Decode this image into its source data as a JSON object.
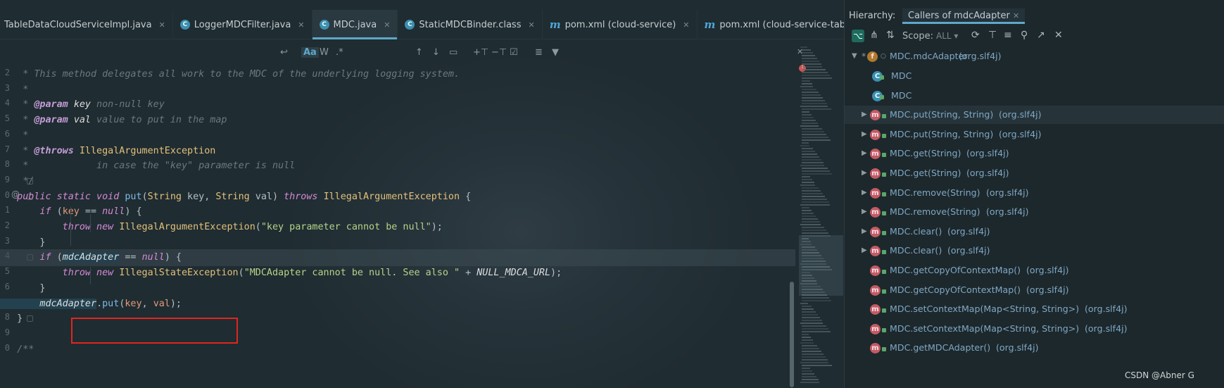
{
  "tabs": [
    {
      "label": "TableDataCloudServiceImpl.java",
      "icon": "class-icon"
    },
    {
      "label": "LoggerMDCFilter.java",
      "icon": "class-icon"
    },
    {
      "label": "MDC.java",
      "icon": "class-icon"
    },
    {
      "label": "StaticMDCBinder.class",
      "icon": "class-icon"
    },
    {
      "label": "pom.xml (cloud-service)",
      "icon": "maven-icon"
    },
    {
      "label": "pom.xml (cloud-service-tabledata)",
      "icon": "maven-icon"
    }
  ],
  "active_tab": "MDC.java",
  "editor_toolbar": {
    "match_case": "Aa",
    "words": "W",
    "regex": ".*"
  },
  "line_numbers": [
    "2",
    "3",
    "4",
    "5",
    "6",
    "7",
    "8",
    "9",
    "0",
    "1",
    "2",
    "3",
    "4",
    "5",
    "6",
    "7",
    "8",
    "9",
    "0"
  ],
  "code": [
    [
      {
        "c": "cmt",
        "t": "    * This method delegates all work to the MDC of the underlying logging system."
      }
    ],
    [
      {
        "c": "cmt",
        "t": "    *"
      }
    ],
    [
      {
        "c": "cmt",
        "t": "    * "
      },
      {
        "c": "tag",
        "t": "@param"
      },
      {
        "c": "cmt",
        "t": " "
      },
      {
        "c": "fld",
        "t": "key"
      },
      {
        "c": "cmt",
        "t": " non-null key"
      }
    ],
    [
      {
        "c": "cmt",
        "t": "    * "
      },
      {
        "c": "tag",
        "t": "@param"
      },
      {
        "c": "cmt",
        "t": " "
      },
      {
        "c": "fld",
        "t": "val"
      },
      {
        "c": "cmt",
        "t": " value to put in the map"
      }
    ],
    [
      {
        "c": "cmt",
        "t": "    *"
      }
    ],
    [
      {
        "c": "cmt",
        "t": "    * "
      },
      {
        "c": "tag",
        "t": "@throws"
      },
      {
        "c": "cmt",
        "t": " "
      },
      {
        "c": "ty",
        "t": "IllegalArgumentException"
      }
    ],
    [
      {
        "c": "cmt",
        "t": "    *            in case the \"key\" parameter is null"
      }
    ],
    [
      {
        "c": "cmt",
        "t": "    */"
      }
    ],
    [
      {
        "c": "kw",
        "t": "   public static void "
      },
      {
        "c": "fn",
        "t": "put"
      },
      {
        "c": "pl",
        "t": "("
      },
      {
        "c": "ty",
        "t": "String"
      },
      {
        "c": "pl",
        "t": " key, "
      },
      {
        "c": "ty",
        "t": "String"
      },
      {
        "c": "pl",
        "t": " val) "
      },
      {
        "c": "kw",
        "t": "throws "
      },
      {
        "c": "ty",
        "t": "IllegalArgumentException"
      },
      {
        "c": "pl",
        "t": " {"
      }
    ],
    [
      {
        "c": "kw",
        "t": "       if "
      },
      {
        "c": "pl",
        "t": "("
      },
      {
        "c": "prm",
        "t": "key"
      },
      {
        "c": "pl",
        "t": " == "
      },
      {
        "c": "kw",
        "t": "null"
      },
      {
        "c": "pl",
        "t": ") {"
      }
    ],
    [
      {
        "c": "kw",
        "t": "           throw new "
      },
      {
        "c": "ty",
        "t": "IllegalArgumentException"
      },
      {
        "c": "pl",
        "t": "("
      },
      {
        "c": "str",
        "t": "\"key parameter cannot be null\""
      },
      {
        "c": "pl",
        "t": ");"
      }
    ],
    [
      {
        "c": "pl",
        "t": "       }"
      }
    ],
    [
      {
        "c": "kw",
        "t": "       if "
      },
      {
        "c": "pl",
        "t": "("
      },
      {
        "c": "fld hl",
        "t": "mdcAdapter"
      },
      {
        "c": "pl",
        "t": " == "
      },
      {
        "c": "kw",
        "t": "null"
      },
      {
        "c": "pl",
        "t": ") {"
      }
    ],
    [
      {
        "c": "kw",
        "t": "           throw new "
      },
      {
        "c": "ty",
        "t": "IllegalStateException"
      },
      {
        "c": "pl",
        "t": "("
      },
      {
        "c": "str",
        "t": "\"MDCAdapter cannot be null. See also \""
      },
      {
        "c": "pl",
        "t": " + "
      },
      {
        "c": "fld",
        "t": "NULL_MDCA_URL"
      },
      {
        "c": "pl",
        "t": ");"
      }
    ],
    [
      {
        "c": "pl",
        "t": "       }"
      }
    ],
    [
      {
        "c": "fld hl",
        "t": "       mdcAdapter"
      },
      {
        "c": "pl",
        "t": "."
      },
      {
        "c": "fn",
        "t": "put"
      },
      {
        "c": "pl",
        "t": "("
      },
      {
        "c": "prm",
        "t": "key"
      },
      {
        "c": "pl",
        "t": ", "
      },
      {
        "c": "prm",
        "t": "val"
      },
      {
        "c": "pl",
        "t": ");"
      }
    ],
    [
      {
        "c": "pl",
        "t": "   }"
      }
    ],
    [
      {
        "c": "pl",
        "t": ""
      }
    ],
    [
      {
        "c": "cmt",
        "t": "   /**"
      }
    ]
  ],
  "panel": {
    "title": "Hierarchy:",
    "tab": "Callers of mdcAdapter",
    "scope_label": "Scope:",
    "scope_value": "ALL",
    "root": {
      "name": "MDC.mdcAdapter",
      "pkg": "(org.slf4j)"
    },
    "rows": [
      {
        "name": "MDC",
        "pkg": "",
        "kind": "class",
        "arrow": false,
        "sel": false
      },
      {
        "name": "MDC",
        "pkg": "",
        "kind": "class",
        "arrow": false,
        "sel": false
      },
      {
        "name": "MDC.put(String, String)",
        "pkg": "(org.slf4j)",
        "kind": "method",
        "arrow": true,
        "sel": true
      },
      {
        "name": "MDC.put(String, String)",
        "pkg": "(org.slf4j)",
        "kind": "method",
        "arrow": true,
        "sel": false
      },
      {
        "name": "MDC.get(String)",
        "pkg": "(org.slf4j)",
        "kind": "method",
        "arrow": true,
        "sel": false
      },
      {
        "name": "MDC.get(String)",
        "pkg": "(org.slf4j)",
        "kind": "method",
        "arrow": true,
        "sel": false
      },
      {
        "name": "MDC.remove(String)",
        "pkg": "(org.slf4j)",
        "kind": "method",
        "arrow": true,
        "sel": false
      },
      {
        "name": "MDC.remove(String)",
        "pkg": "(org.slf4j)",
        "kind": "method",
        "arrow": true,
        "sel": false
      },
      {
        "name": "MDC.clear()",
        "pkg": "(org.slf4j)",
        "kind": "method",
        "arrow": true,
        "sel": false
      },
      {
        "name": "MDC.clear()",
        "pkg": "(org.slf4j)",
        "kind": "method",
        "arrow": true,
        "sel": false
      },
      {
        "name": "MDC.getCopyOfContextMap()",
        "pkg": "(org.slf4j)",
        "kind": "method",
        "arrow": false,
        "sel": false
      },
      {
        "name": "MDC.getCopyOfContextMap()",
        "pkg": "(org.slf4j)",
        "kind": "method",
        "arrow": false,
        "sel": false
      },
      {
        "name": "MDC.setContextMap(Map<String, String>)",
        "pkg": "(org.slf4j)",
        "kind": "method",
        "arrow": false,
        "sel": false
      },
      {
        "name": "MDC.setContextMap(Map<String, String>)",
        "pkg": "(org.slf4j)",
        "kind": "method",
        "arrow": false,
        "sel": false
      },
      {
        "name": "MDC.getMDCAdapter()",
        "pkg": "(org.slf4j)",
        "kind": "method",
        "arrow": false,
        "sel": false
      }
    ]
  },
  "watermark": "CSDN @Abner G",
  "colors": {
    "highlight_box": "#e0261e",
    "accent": "#5fa8c9"
  }
}
